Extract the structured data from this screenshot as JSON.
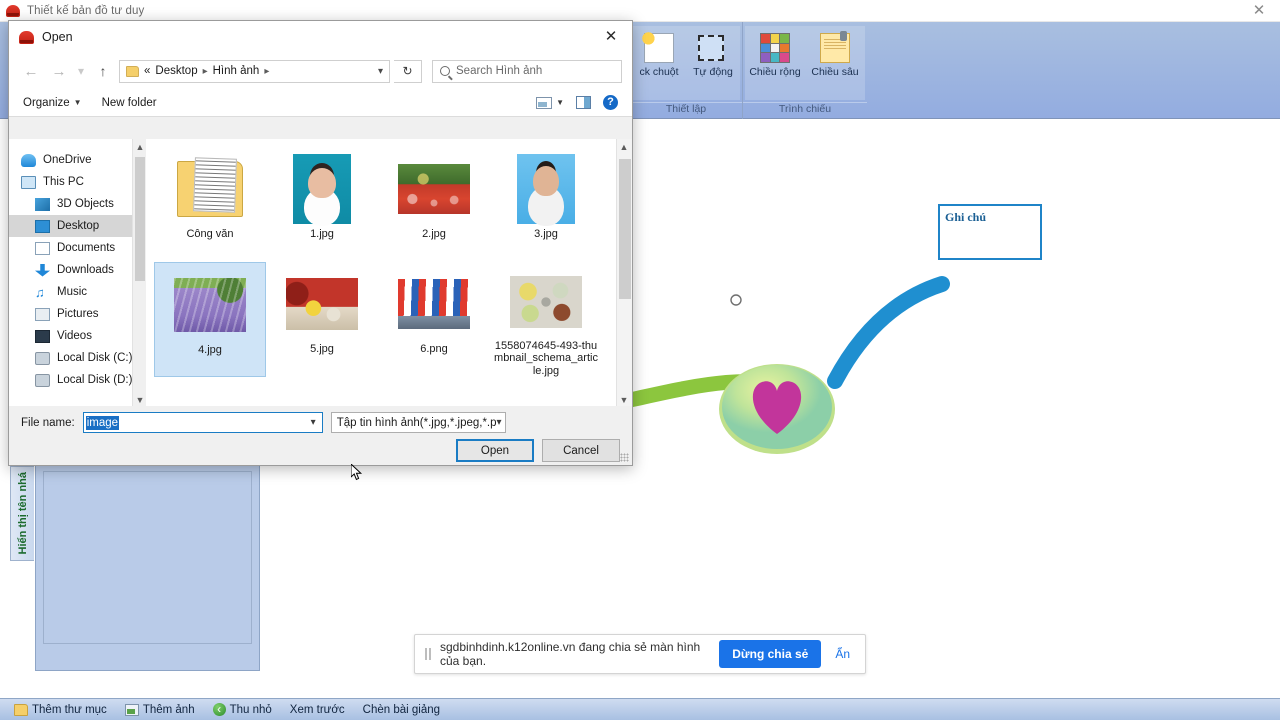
{
  "app": {
    "title": "Thiết kế bản đồ tư duy",
    "logo_icon": "mindmap-app-icon",
    "close_icon": "close-icon"
  },
  "ribbon": {
    "groups": [
      {
        "name": "Thiết lập",
        "buttons": [
          {
            "label": "ck chuột",
            "icon": "magic-document-icon"
          },
          {
            "label": "Tự động",
            "icon": "dashed-square-icon"
          }
        ]
      },
      {
        "name": "Trình chiếu",
        "buttons": [
          {
            "label": "Chiều rộng",
            "icon": "color-grid-icon"
          },
          {
            "label": "Chiều sâu",
            "icon": "sticky-note-icon"
          }
        ]
      }
    ]
  },
  "canvas": {
    "note": {
      "text": "Ghi chú",
      "border_color": "#1f84c8"
    },
    "branches": [
      {
        "name": "green-branch",
        "color": "#8cc63e"
      },
      {
        "name": "blue-branch",
        "color": "#1f8fd0"
      }
    ],
    "central_node": {
      "name": "heart-node",
      "fill": "#c2359b"
    }
  },
  "left_panel": {
    "tab_label": "Hiển thị tên nhá"
  },
  "share_bar": {
    "message": "sgdbinhdinh.k12online.vn đang chia sẻ màn hình của bạn.",
    "stop_label": "Dừng chia sẻ",
    "hide_label": "Ẩn",
    "accent": "#1a73e8",
    "pause_icon": "pause-icon"
  },
  "taskbar": {
    "items": [
      {
        "label": "Thêm thư mục",
        "icon": "folder-icon"
      },
      {
        "label": "Thêm ảnh",
        "icon": "image-icon"
      },
      {
        "label": "Thu nhỏ",
        "icon": "back-circle-icon"
      },
      {
        "label": "Xem trước",
        "icon": ""
      },
      {
        "label": "Chèn bài giảng",
        "icon": ""
      }
    ]
  },
  "dialog": {
    "title": "Open",
    "close_icon": "close-icon",
    "nav": {
      "back_icon": "arrow-left-icon",
      "forward_icon": "arrow-right-icon",
      "recent_icon": "chevron-down-icon",
      "up_icon": "arrow-up-icon",
      "breadcrumb": {
        "folder_icon": "folder-icon",
        "prefix": "«",
        "parts": [
          "Desktop",
          "Hình ảnh"
        ],
        "caret_icon": "chevron-down-icon"
      },
      "refresh_icon": "refresh-icon",
      "search": {
        "placeholder": "Search Hình ảnh",
        "icon": "search-icon"
      }
    },
    "commands": {
      "organize": "Organize",
      "new_folder": "New folder",
      "view_icon": "view-layout-icon",
      "view_caret_icon": "chevron-down-icon",
      "preview_pane_icon": "preview-pane-icon",
      "help_icon": "help-icon"
    },
    "sidebar": [
      {
        "label": "OneDrive",
        "icon": "onedrive-icon",
        "indent": false,
        "selected": false
      },
      {
        "label": "This PC",
        "icon": "this-pc-icon",
        "indent": false,
        "selected": false
      },
      {
        "label": "3D Objects",
        "icon": "3d-objects-icon",
        "indent": true,
        "selected": false
      },
      {
        "label": "Desktop",
        "icon": "desktop-icon",
        "indent": true,
        "selected": true
      },
      {
        "label": "Documents",
        "icon": "documents-icon",
        "indent": true,
        "selected": false
      },
      {
        "label": "Downloads",
        "icon": "downloads-icon",
        "indent": true,
        "selected": false
      },
      {
        "label": "Music",
        "icon": "music-icon",
        "indent": true,
        "selected": false
      },
      {
        "label": "Pictures",
        "icon": "pictures-icon",
        "indent": true,
        "selected": false
      },
      {
        "label": "Videos",
        "icon": "videos-icon",
        "indent": true,
        "selected": false
      },
      {
        "label": "Local Disk (C:)",
        "icon": "disk-icon",
        "indent": true,
        "selected": false
      },
      {
        "label": "Local Disk (D:)",
        "icon": "disk-icon",
        "indent": true,
        "selected": false
      }
    ],
    "files": [
      {
        "name": "Công văn",
        "thumb": "t-folder",
        "selected": false
      },
      {
        "name": "1.jpg",
        "thumb": "t-portrait-f",
        "selected": false
      },
      {
        "name": "2.jpg",
        "thumb": "t-crowd",
        "selected": false
      },
      {
        "name": "3.jpg",
        "thumb": "t-portrait-m",
        "selected": false
      },
      {
        "name": "4.jpg",
        "thumb": "t-lavender",
        "selected": true
      },
      {
        "name": "5.jpg",
        "thumb": "t-ceremony",
        "selected": false
      },
      {
        "name": "6.png",
        "thumb": "t-tent",
        "selected": false
      },
      {
        "name": "1558074645-493-thumbnail_schema_article.jpg",
        "thumb": "t-food",
        "selected": false
      }
    ],
    "footer": {
      "file_name_label": "File name:",
      "file_name_value": "image",
      "file_type_value": "Tập tin hình ảnh(*.jpg,*.jpeg,*.p",
      "open_label": "Open",
      "cancel_label": "Cancel",
      "caret_icon": "chevron-down-icon"
    }
  }
}
